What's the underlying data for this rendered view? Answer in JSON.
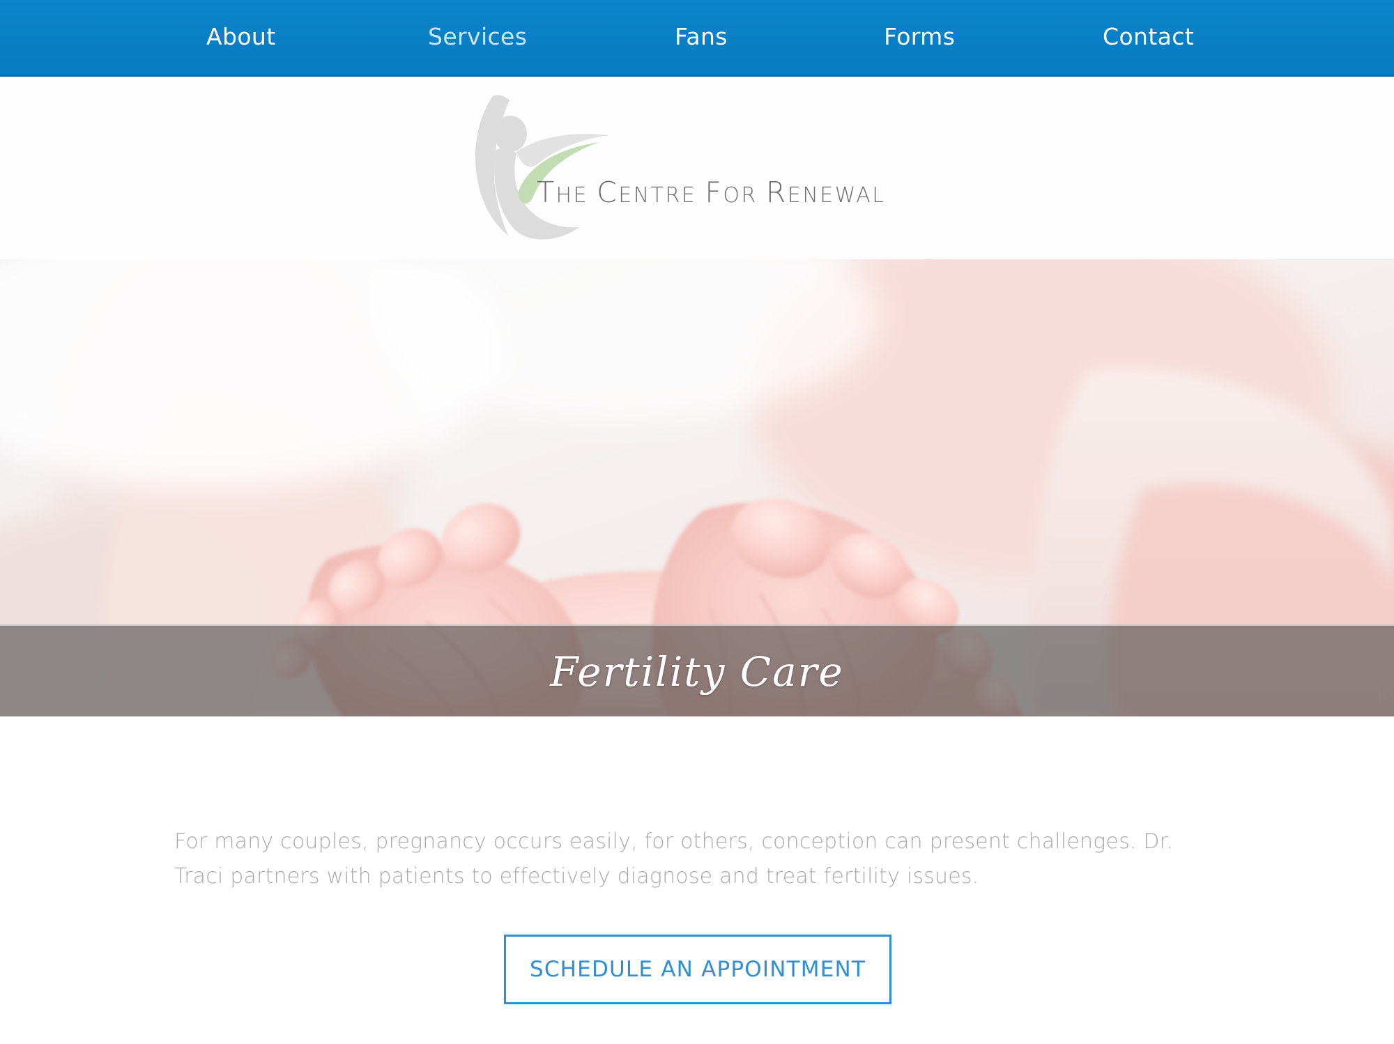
{
  "nav": {
    "items": [
      {
        "label": "About",
        "state": "active"
      },
      {
        "label": "Services",
        "state": "dim"
      },
      {
        "label": "Fans",
        "state": "normal"
      },
      {
        "label": "Forms",
        "state": "normal"
      },
      {
        "label": "Contact",
        "state": "normal"
      }
    ],
    "background_color": "#0a80c8",
    "text_color": "#ffffff"
  },
  "logo": {
    "word_the": "T",
    "word_the_rest": "HE ",
    "word_centre_cap": "C",
    "word_centre_rest": "ENTRE ",
    "word_for_cap": "F",
    "word_for_rest": "OR ",
    "word_renewal_cap": "R",
    "word_renewal_rest": "ENEWAL",
    "full_text": "The Centre For Renewal",
    "figure_color": "#dedede",
    "swoosh_gray": "#e0e0e0",
    "swoosh_green": "#c2ddb4",
    "text_color": "#6d6d6d"
  },
  "hero": {
    "title": "Fertility  Care",
    "image_alt": "baby-feet-photo",
    "band_color": "rgba(74,74,74,0.60)"
  },
  "main": {
    "paragraph": "For many couples, pregnancy occurs easily, for others, conception can present challenges.  Dr. Traci partners with patients to effectively diagnose and treat fertility issues.",
    "cta_label": "SCHEDULE AN APPOINTMENT",
    "cta_color": "#2f8fd4",
    "text_color": "#a9a9a9"
  }
}
